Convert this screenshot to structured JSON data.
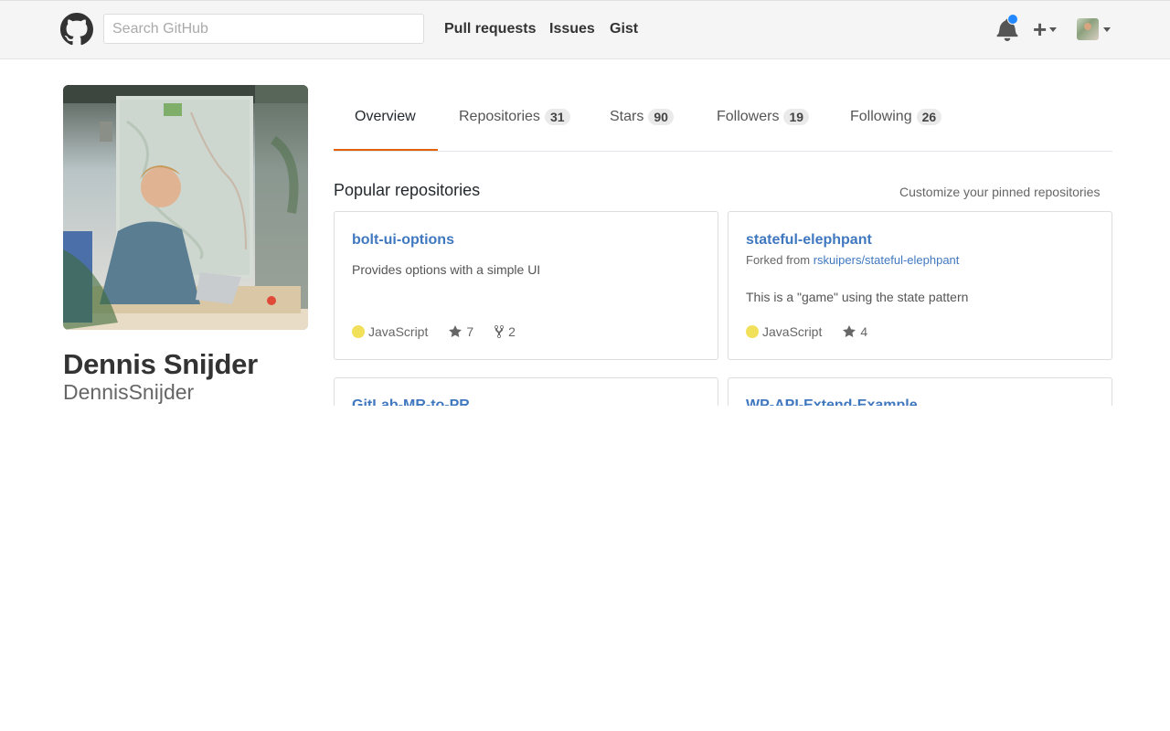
{
  "header": {
    "search_placeholder": "Search GitHub",
    "nav": [
      "Pull requests",
      "Issues",
      "Gist"
    ],
    "plus_symbol": "+"
  },
  "profile": {
    "name": "Dennis Snijder",
    "username": "DennisSnijder"
  },
  "tabs": [
    {
      "label": "Overview",
      "count": null,
      "active": true
    },
    {
      "label": "Repositories",
      "count": "31"
    },
    {
      "label": "Stars",
      "count": "90"
    },
    {
      "label": "Followers",
      "count": "19"
    },
    {
      "label": "Following",
      "count": "26"
    }
  ],
  "popular": {
    "title": "Popular repositories",
    "customize": "Customize your pinned repositories",
    "repos": [
      {
        "name": "bolt-ui-options",
        "description": "Provides options with a simple UI",
        "language": "JavaScript",
        "stars": "7",
        "forks": "2"
      },
      {
        "name": "stateful-elephpant",
        "forked_prefix": "Forked from",
        "forked_from": "rskuipers/stateful-elephpant",
        "description": "This is a \"game\" using the state pattern",
        "language": "JavaScript",
        "stars": "4"
      },
      {
        "name": "GitLab-MR-to-PR"
      },
      {
        "name": "WP-API-Extend-Example"
      }
    ]
  },
  "colors": {
    "link": "#4078c0",
    "tab_active_underline": "#e36209",
    "javascript": "#f1e05a",
    "notification": "#2188ff"
  }
}
